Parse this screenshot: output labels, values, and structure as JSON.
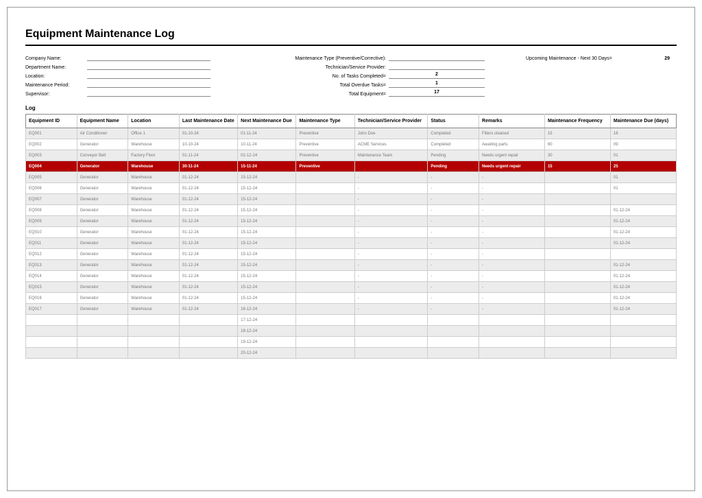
{
  "title": "Equipment Maintenance Log",
  "meta": {
    "left_labels": [
      "Company Name:",
      "Department Name:",
      "Location:",
      "Maintenance Period:",
      "Supervisor:"
    ],
    "mid": [
      {
        "label": "Maintenance Type (Preventive/Corrective):",
        "value": ""
      },
      {
        "label": "Technician/Service Provider:",
        "value": ""
      },
      {
        "label": "No. of Tasks Completed=",
        "value": "2"
      },
      {
        "label": "Total Overdue Tasks=",
        "value": "1"
      },
      {
        "label": "Total Equipment=",
        "value": "17"
      }
    ],
    "right": {
      "label": "Upcoming Maintenance - Next 30 Days=",
      "value": "29"
    }
  },
  "section_label": "Log",
  "columns": [
    "Equipment ID",
    "Equipment Name",
    "Location",
    "Last Maintenance Date",
    "Next Maintenance Due",
    "Maintenance Type",
    "Technician/Service Provider",
    "Status",
    "Remarks",
    "Maintenance Frequency",
    "Maintenance Due (days)"
  ],
  "rows": [
    {
      "id": "EQ001",
      "name": "Air Conditioner",
      "loc": "Office 1",
      "last": "01-10-24",
      "next": "01-11-24",
      "type": "Preventive",
      "tech": "John Doe",
      "status": "Completed",
      "remarks": "Filters cleaned",
      "freq": "15",
      "due": "16",
      "hl": false
    },
    {
      "id": "EQ002",
      "name": "Generator",
      "loc": "Warehouse",
      "last": "10-10-24",
      "next": "10-11-24",
      "type": "Preventive",
      "tech": "ACME Services",
      "status": "Completed",
      "remarks": "Awaiting parts",
      "freq": "60",
      "due": "09",
      "hl": false
    },
    {
      "id": "EQ003",
      "name": "Conveyor Belt",
      "loc": "Factory Floor",
      "last": "01-11-24",
      "next": "02-12-24",
      "type": "Preventive",
      "tech": "Maintenance Team",
      "status": "Pending",
      "remarks": "Needs urgent repair",
      "freq": "30",
      "due": "01",
      "hl": false
    },
    {
      "id": "EQ004",
      "name": "Generator",
      "loc": "Warehouse",
      "last": "30-11-24",
      "next": "15-11-24",
      "type": "Preventive",
      "tech": "",
      "status": "Pending",
      "remarks": "Needs urgent repair",
      "freq": "15",
      "due": "25",
      "hl": true
    },
    {
      "id": "EQ005",
      "name": "Generator",
      "loc": "Warehouse",
      "last": "01-12-24",
      "next": "15-12-24",
      "type": "",
      "tech": "-",
      "status": "-",
      "remarks": "-",
      "freq": "",
      "due": "01",
      "hl": false
    },
    {
      "id": "EQ006",
      "name": "Generator",
      "loc": "Warehouse",
      "last": "01-12-24",
      "next": "15-12-24",
      "type": "",
      "tech": "-",
      "status": "-",
      "remarks": "-",
      "freq": "",
      "due": "01",
      "hl": false
    },
    {
      "id": "EQ007",
      "name": "Generator",
      "loc": "Warehouse",
      "last": "01-12-24",
      "next": "15-12-24",
      "type": "",
      "tech": "-",
      "status": "-",
      "remarks": "-",
      "freq": "",
      "due": "",
      "hl": false
    },
    {
      "id": "EQ008",
      "name": "Generator",
      "loc": "Warehouse",
      "last": "01-12-24",
      "next": "15-12-24",
      "type": "",
      "tech": "-",
      "status": "-",
      "remarks": "-",
      "freq": "",
      "due": "01-12-24",
      "hl": false
    },
    {
      "id": "EQ009",
      "name": "Generator",
      "loc": "Warehouse",
      "last": "01-12-24",
      "next": "15-12-24",
      "type": "",
      "tech": "-",
      "status": "-",
      "remarks": "-",
      "freq": "",
      "due": "01-12-24",
      "hl": false
    },
    {
      "id": "EQ010",
      "name": "Generator",
      "loc": "Warehouse",
      "last": "01-12-24",
      "next": "15-12-24",
      "type": "",
      "tech": "-",
      "status": "-",
      "remarks": "-",
      "freq": "",
      "due": "01-12-24",
      "hl": false
    },
    {
      "id": "EQ011",
      "name": "Generator",
      "loc": "Warehouse",
      "last": "01-12-24",
      "next": "15-12-24",
      "type": "",
      "tech": "-",
      "status": "-",
      "remarks": "-",
      "freq": "",
      "due": "01-12-24",
      "hl": false
    },
    {
      "id": "EQ012",
      "name": "Generator",
      "loc": "Warehouse",
      "last": "01-12-24",
      "next": "15-12-24",
      "type": "",
      "tech": "-",
      "status": "-",
      "remarks": "-",
      "freq": "",
      "due": "",
      "hl": false
    },
    {
      "id": "EQ013",
      "name": "Generator",
      "loc": "Warehouse",
      "last": "01-12-24",
      "next": "15-12-24",
      "type": "",
      "tech": "-",
      "status": "-",
      "remarks": "-",
      "freq": "",
      "due": "01-12-24",
      "hl": false
    },
    {
      "id": "EQ014",
      "name": "Generator",
      "loc": "Warehouse",
      "last": "01-12-24",
      "next": "15-12-24",
      "type": "",
      "tech": "-",
      "status": "-",
      "remarks": "-",
      "freq": "",
      "due": "01-12-24",
      "hl": false
    },
    {
      "id": "EQ015",
      "name": "Generator",
      "loc": "Warehouse",
      "last": "01-12-24",
      "next": "15-12-24",
      "type": "",
      "tech": "-",
      "status": "-",
      "remarks": "-",
      "freq": "",
      "due": "01-12-24",
      "hl": false
    },
    {
      "id": "EQ016",
      "name": "Generator",
      "loc": "Warehouse",
      "last": "01-12-24",
      "next": "15-12-24",
      "type": "",
      "tech": "-",
      "status": "-",
      "remarks": "-",
      "freq": "",
      "due": "01-12-24",
      "hl": false
    },
    {
      "id": "EQ017",
      "name": "Generator",
      "loc": "Warehouse",
      "last": "01-12-24",
      "next": "16-12-24",
      "type": "",
      "tech": "-",
      "status": "-",
      "remarks": "-",
      "freq": "",
      "due": "01-12-24",
      "hl": false
    },
    {
      "id": "",
      "name": "",
      "loc": "",
      "last": "",
      "next": "17-12-24",
      "type": "",
      "tech": "",
      "status": "",
      "remarks": "",
      "freq": "",
      "due": "",
      "hl": false
    },
    {
      "id": "",
      "name": "",
      "loc": "",
      "last": "",
      "next": "18-12-24",
      "type": "",
      "tech": "",
      "status": "",
      "remarks": "",
      "freq": "",
      "due": "",
      "hl": false
    },
    {
      "id": "",
      "name": "",
      "loc": "",
      "last": "",
      "next": "19-12-24",
      "type": "",
      "tech": "",
      "status": "",
      "remarks": "",
      "freq": "",
      "due": "",
      "hl": false
    },
    {
      "id": "",
      "name": "",
      "loc": "",
      "last": "",
      "next": "20-12-24",
      "type": "",
      "tech": "",
      "status": "",
      "remarks": "",
      "freq": "",
      "due": "",
      "hl": false
    }
  ]
}
